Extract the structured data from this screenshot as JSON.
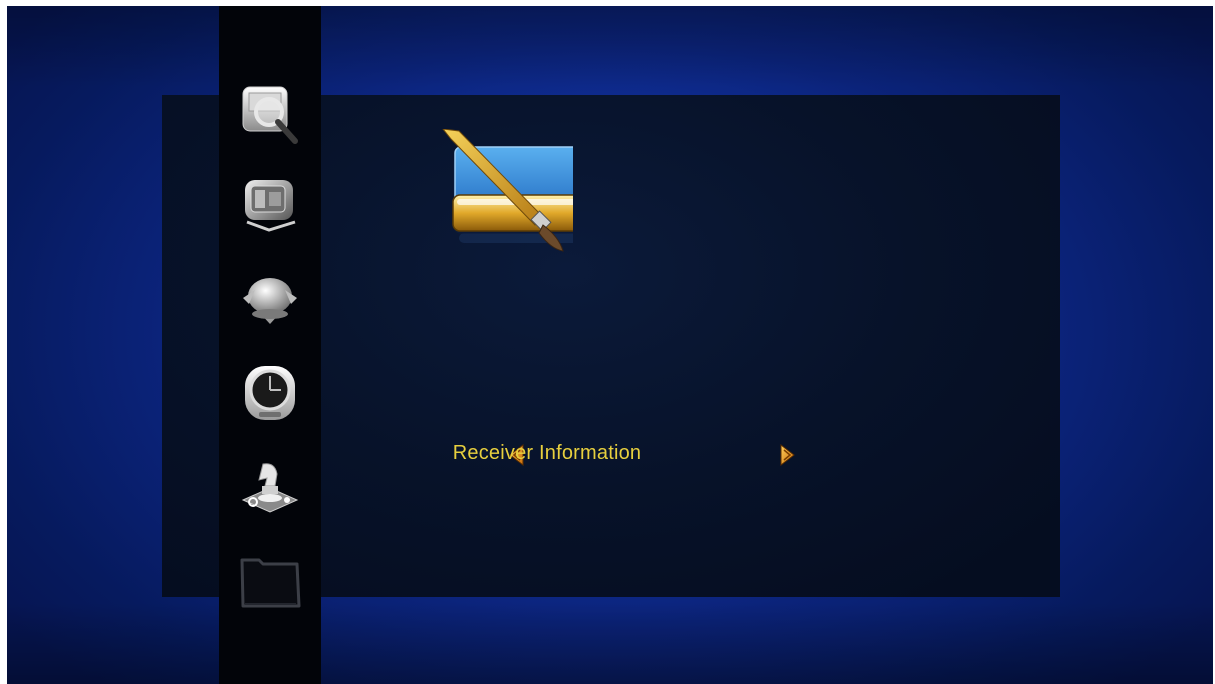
{
  "menu": {
    "current_item_label": "Receiver Information",
    "label_color": "#e7cf3e"
  },
  "sidebar": {
    "items": [
      {
        "icon": "channel-search-icon"
      },
      {
        "icon": "satellite-receiver-icon"
      },
      {
        "icon": "globe-network-icon"
      },
      {
        "icon": "clock-time-icon"
      },
      {
        "icon": "chess-game-icon"
      },
      {
        "icon": "folder-icon"
      }
    ]
  },
  "feature": {
    "icon": "paintbrush-drive-icon"
  },
  "colors": {
    "background_blue": "#1235a8",
    "panel_dark": "#071229",
    "accent_yellow": "#e7cf3e",
    "arrow_orange": "#e89a1a"
  }
}
